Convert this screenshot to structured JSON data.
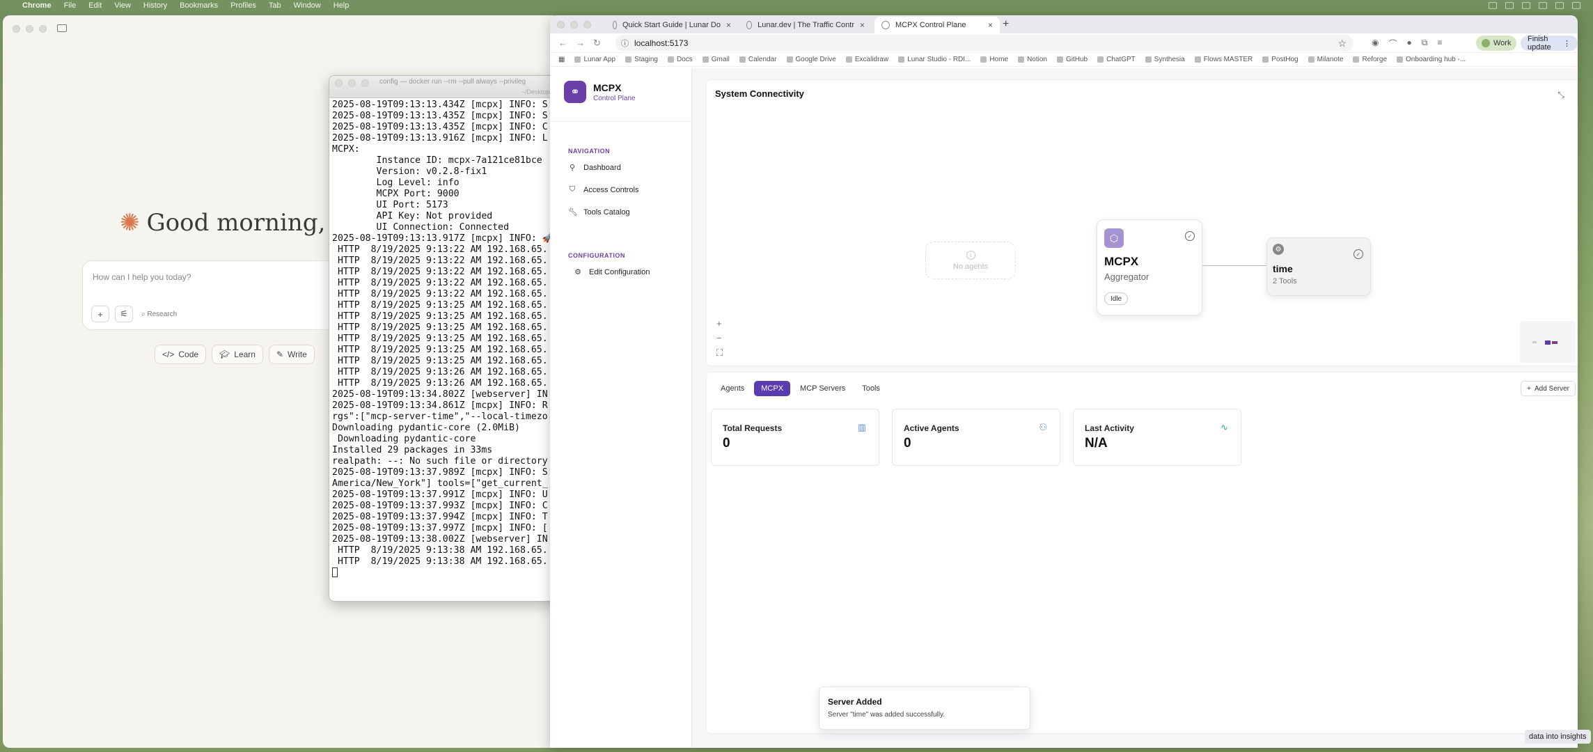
{
  "menubar": {
    "app": "Chrome",
    "items": [
      "File",
      "Edit",
      "View",
      "History",
      "Bookmarks",
      "Profiles",
      "Tab",
      "Window",
      "Help"
    ]
  },
  "claude": {
    "greeting": "Good morning, Lu",
    "input_placeholder": "How can I help you today?",
    "research_label": "Research",
    "quick_actions": [
      "Code",
      "Learn",
      "Write"
    ]
  },
  "terminal": {
    "title": "config — docker run --rm --pull always --privileg",
    "subtitle": "~/Desktop/L",
    "lines": [
      "2025-08-19T09:13:13.434Z [mcpx] INFO: S",
      "2025-08-19T09:13:13.435Z [mcpx] INFO: S",
      "2025-08-19T09:13:13.435Z [mcpx] INFO: C",
      "2025-08-19T09:13:13.916Z [mcpx] INFO: L",
      "MCPX:",
      "        Instance ID: mcpx-7a121ce81bce",
      "        Version: v0.2.8-fix1",
      "        Log Level: info",
      "        MCPX Port: 9000",
      "        UI Port: 5173",
      "        API Key: Not provided",
      "        UI Connection: Connected",
      "2025-08-19T09:13:13.917Z [mcpx] INFO: 🚀",
      " HTTP  8/19/2025 9:13:22 AM 192.168.65.",
      " HTTP  8/19/2025 9:13:22 AM 192.168.65.",
      " HTTP  8/19/2025 9:13:22 AM 192.168.65.",
      " HTTP  8/19/2025 9:13:22 AM 192.168.65.",
      " HTTP  8/19/2025 9:13:22 AM 192.168.65.",
      " HTTP  8/19/2025 9:13:25 AM 192.168.65.",
      " HTTP  8/19/2025 9:13:25 AM 192.168.65.",
      " HTTP  8/19/2025 9:13:25 AM 192.168.65.",
      " HTTP  8/19/2025 9:13:25 AM 192.168.65.",
      " HTTP  8/19/2025 9:13:25 AM 192.168.65.",
      " HTTP  8/19/2025 9:13:25 AM 192.168.65.",
      " HTTP  8/19/2025 9:13:26 AM 192.168.65.",
      " HTTP  8/19/2025 9:13:26 AM 192.168.65.",
      "2025-08-19T09:13:34.802Z [webserver] IN",
      "2025-08-19T09:13:34.861Z [mcpx] INFO: R",
      "rgs\":[\"mcp-server-time\",\"--local-timezo",
      "Downloading pydantic-core (2.0MiB)",
      " Downloading pydantic-core",
      "Installed 29 packages in 33ms",
      "realpath: --: No such file or directory",
      "2025-08-19T09:13:37.989Z [mcpx] INFO: S",
      "America/New_York\"] tools=[\"get_current_",
      "2025-08-19T09:13:37.991Z [mcpx] INFO: U",
      "2025-08-19T09:13:37.993Z [mcpx] INFO: C",
      "2025-08-19T09:13:37.994Z [mcpx] INFO: T",
      "2025-08-19T09:13:37.997Z [mcpx] INFO: [",
      "2025-08-19T09:13:38.002Z [webserver] IN",
      " HTTP  8/19/2025 9:13:38 AM 192.168.65.",
      " HTTP  8/19/2025 9:13:38 AM 192.168.65."
    ]
  },
  "chrome": {
    "tabs": [
      {
        "title": "Quick Start Guide | Lunar Do",
        "active": false
      },
      {
        "title": "Lunar.dev | The Traffic Contr",
        "active": false
      },
      {
        "title": "MCPX Control Plane",
        "active": true
      }
    ],
    "url": "localhost:5173",
    "profile": "Work",
    "finish_update": "Finish update",
    "bookmarks": [
      "Lunar App",
      "Staging",
      "Docs",
      "Gmail",
      "Calendar",
      "Google Drive",
      "Excalidraw",
      "Lunar Studio - RDI...",
      "Home",
      "Notion",
      "GitHub",
      "ChatGPT",
      "Synthesia",
      "Flows MASTER",
      "PostHog",
      "Milanote",
      "Reforge",
      "Onboarding hub -..."
    ]
  },
  "app": {
    "brand": {
      "name": "MCPX",
      "subtitle": "Control Plane"
    },
    "nav_section": "NAVIGATION",
    "nav": [
      "Dashboard",
      "Access Controls",
      "Tools Catalog"
    ],
    "config_section": "CONFIGURATION",
    "config_nav": [
      "Edit Configuration"
    ],
    "connectivity": {
      "title": "System Connectivity",
      "no_agents": "No agents",
      "mcpx_node": {
        "name": "MCPX",
        "role": "Aggregator",
        "status": "Idle"
      },
      "server_node": {
        "name": "time",
        "tools": "2 Tools"
      },
      "zoom": [
        "+",
        "−",
        "⛶"
      ]
    },
    "tabs": [
      "Agents",
      "MCPX",
      "MCP Servers",
      "Tools"
    ],
    "active_tab": "MCPX",
    "add_server": "Add Server",
    "cards": [
      {
        "label": "Total Requests",
        "value": "0",
        "icon": "bar-chart-icon"
      },
      {
        "label": "Active Agents",
        "value": "0",
        "icon": "users-icon"
      },
      {
        "label": "Last Activity",
        "value": "N/A",
        "icon": "activity-icon"
      }
    ],
    "toast": {
      "title": "Server Added",
      "message": "Server \"time\" was added successfully."
    }
  },
  "insight_tag": "data into insights"
}
